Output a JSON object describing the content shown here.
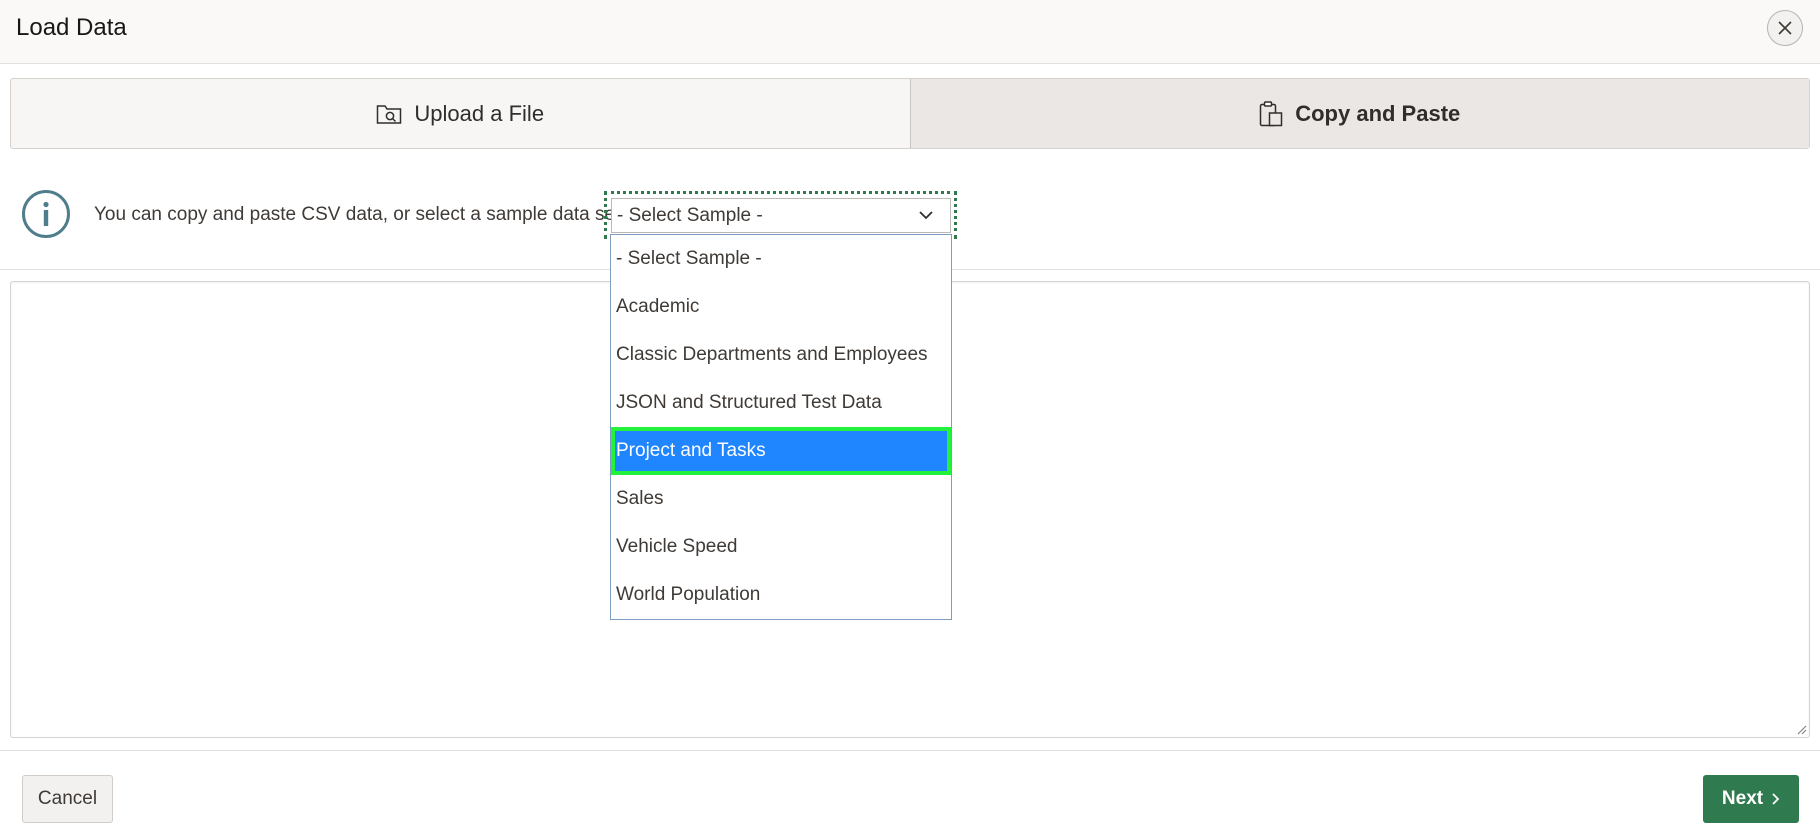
{
  "dialog": {
    "title": "Load Data"
  },
  "tabs": [
    {
      "label": "Upload a File",
      "icon": "upload-folder-icon",
      "active": false
    },
    {
      "label": "Copy and Paste",
      "icon": "clipboard-icon",
      "active": true
    }
  ],
  "info": {
    "icon": "info-icon",
    "text": "You can copy and paste CSV data, or select a sample data set."
  },
  "sample_select": {
    "value": "- Select Sample -",
    "options": [
      "- Select Sample -",
      "Academic",
      "Classic Departments and Employees",
      "JSON and Structured Test Data",
      "Project and Tasks",
      "Sales",
      "Vehicle Speed",
      "World Population"
    ],
    "highlighted": "Project and Tasks"
  },
  "paste_area": {
    "value": ""
  },
  "footer": {
    "cancel_label": "Cancel",
    "next_label": "Next"
  },
  "colors": {
    "primary_button": "#2f7a4e",
    "highlight": "#1f86ff",
    "highlight_outline": "#22f23c",
    "info_icon": "#4f7d8c"
  }
}
